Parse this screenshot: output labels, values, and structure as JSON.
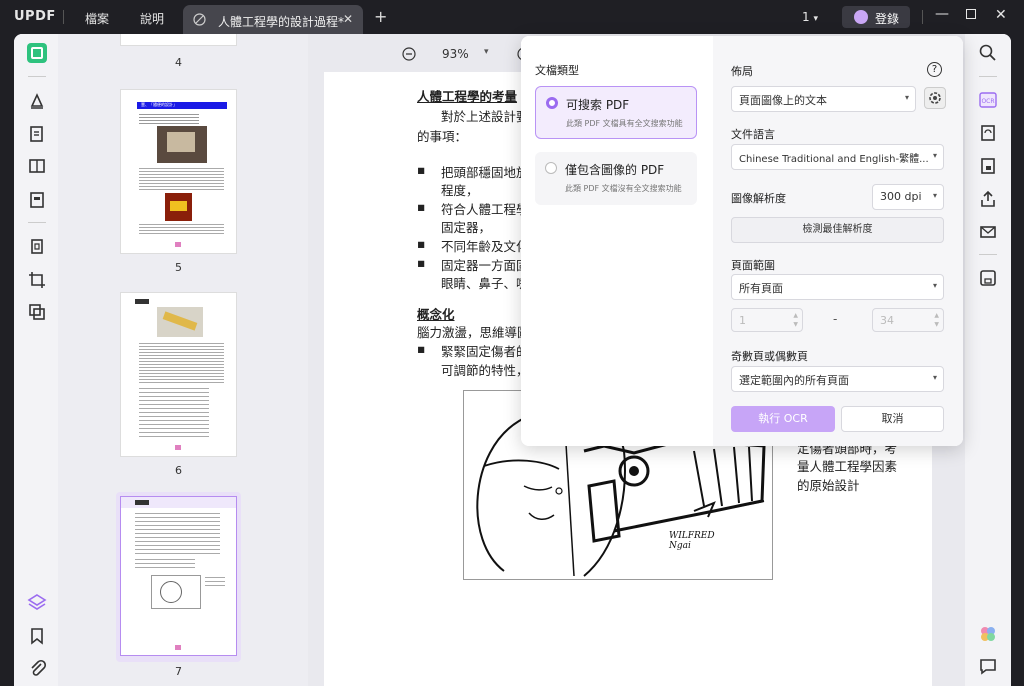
{
  "titlebar": {
    "logo": "UPDF",
    "menu_file": "檔案",
    "menu_help": "說明",
    "tab_title": "人體工程學的設計過程*",
    "page_indicator": "1",
    "login": "登錄"
  },
  "thumbs": {
    "labels": [
      "4",
      "5",
      "6",
      "7"
    ],
    "thumb_title_5": "壹、「隨便的設計」"
  },
  "viewer": {
    "zoom": "93%"
  },
  "document": {
    "heading1": "人體工程學的考量",
    "line1": "對於上述設計要",
    "line2": "的事項：",
    "bullets1": [
      "把頭部穩固地放",
      "程度，",
      "符合人體工程學",
      "固定器，",
      "不同年齡及文化",
      "固定器一方面固",
      "眼睛、鼻子、嘴"
    ],
    "heading2": "概念化",
    "line3": "腦力激盪，思維導圖",
    "bullets2": [
      "緊緊固定傷者的",
      "可調節的特性，"
    ],
    "side_text": [
      "定傷者頭部時，考",
      "量人體工程學因素",
      "的原始設計"
    ],
    "signature": [
      "WILFRED",
      "Ngai"
    ]
  },
  "ocr": {
    "doc_type_label": "文檔類型",
    "option1_title": "可搜索 PDF",
    "option1_desc": "此類 PDF 文檔具有全文搜索功能",
    "option2_title": "僅包含圖像的 PDF",
    "option2_desc": "此類 PDF 文檔沒有全文搜索功能",
    "layout_label": "佈局",
    "layout_value": "頁面圖像上的文本",
    "language_label": "文件語言",
    "language_value": "Chinese Traditional and English-繁體...",
    "resolution_label": "圖像解析度",
    "resolution_value": "300 dpi",
    "detect_button": "檢測最佳解析度",
    "range_label": "頁面範圍",
    "range_value": "所有頁面",
    "range_from": "1",
    "range_sep": "-",
    "range_to": "34",
    "oddeven_label": "奇數頁或偶數頁",
    "oddeven_value": "選定範圍內的所有頁面",
    "run_button": "執行 OCR",
    "cancel_button": "取消"
  },
  "colors": {
    "accent": "#9b6cf0",
    "accent_light": "#f3ecfd",
    "titlebar": "#1f1f24"
  }
}
